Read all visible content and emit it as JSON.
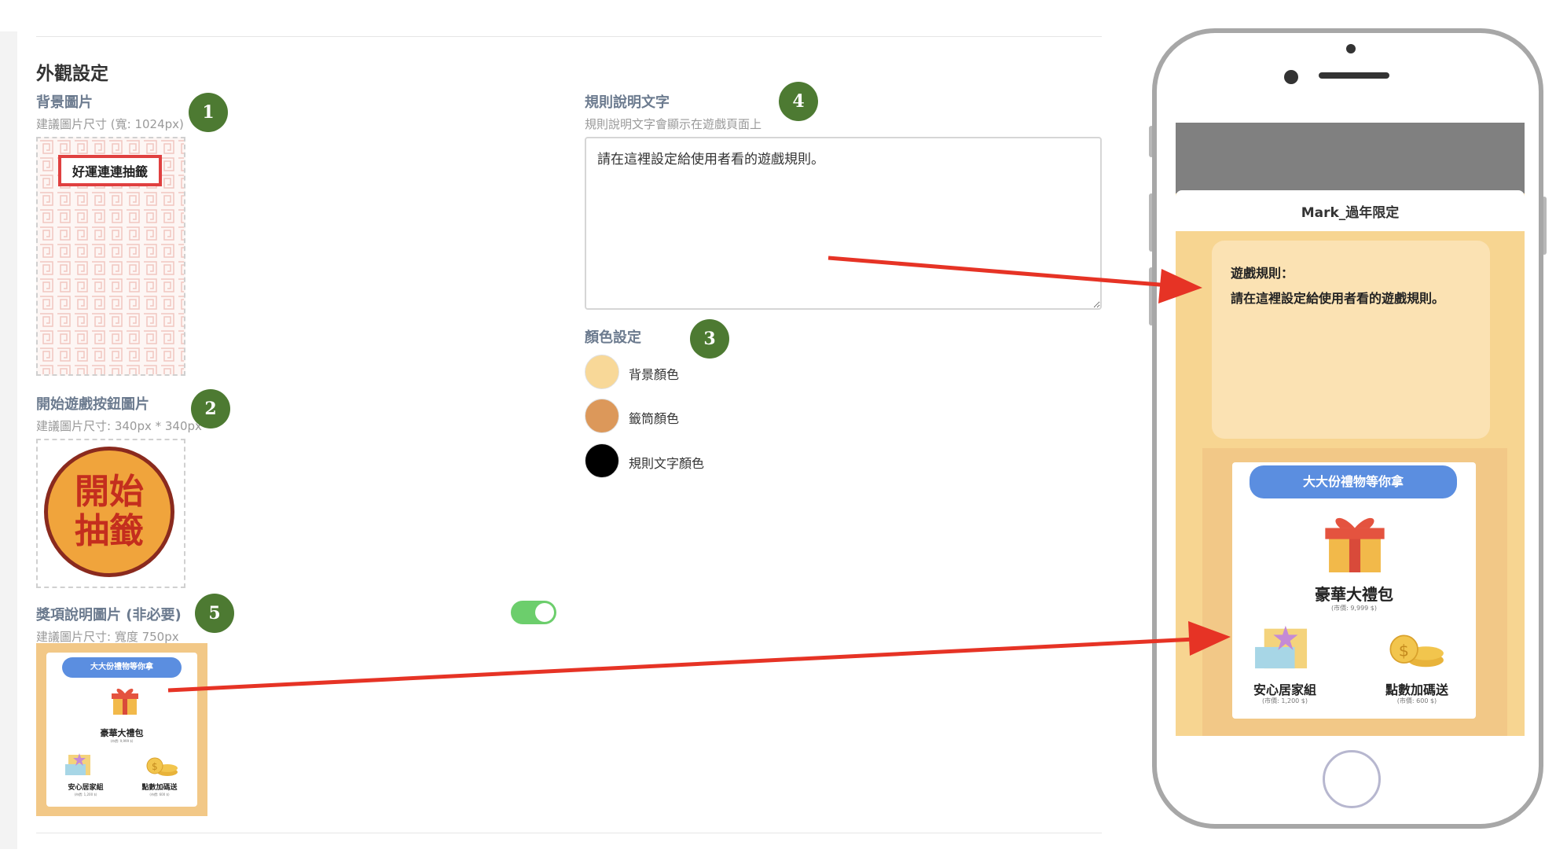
{
  "section_title": "外觀設定",
  "background_image": {
    "label": "背景圖片",
    "hint": "建議圖片尺寸 (寬: 1024px)",
    "title_text": "好運連連抽籤",
    "badge": "1"
  },
  "start_button": {
    "label": "開始遊戲按鈕圖片",
    "hint": "建議圖片尺寸: 340px * 340px",
    "line1": "開始",
    "line2": "抽籤",
    "badge": "2"
  },
  "prize_image": {
    "label": "獎項說明圖片 (非必要)",
    "hint": "建議圖片尺寸: 寬度 750px",
    "toggle_on": true,
    "badge": "5"
  },
  "rules": {
    "label": "規則說明文字",
    "hint": "規則說明文字會顯示在遊戲頁面上",
    "value": "請在這裡設定給使用者看的遊戲規則。",
    "badge": "4"
  },
  "colors": {
    "label": "顏色設定",
    "badge": "3",
    "items": [
      {
        "label": "背景顏色",
        "color": "#f8d898"
      },
      {
        "label": "籤筒顏色",
        "color": "#dc985a"
      },
      {
        "label": "規則文字顏色",
        "color": "#000000"
      }
    ]
  },
  "prize_card": {
    "banner": "大大份禮物等你拿",
    "main_prize": "豪華大禮包",
    "main_price": "(市價: 9,999 $)",
    "prize_a": "安心居家組",
    "prize_a_price": "(市價: 1,200 $)",
    "prize_b": "點數加碼送",
    "prize_b_price": "(市價: 600 $)"
  },
  "phone": {
    "title": "Mark_過年限定",
    "rules_heading": "遊戲規則：",
    "rules_text": "請在這裡設定給使用者看的遊戲規則。"
  },
  "accent_colors": {
    "badge_green": "#4d7a32",
    "arrow_red": "#e63325",
    "pill_blue": "#5b8ee0"
  }
}
